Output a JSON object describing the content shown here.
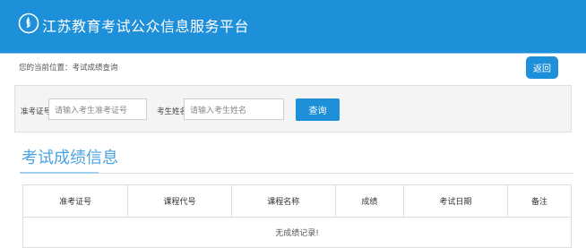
{
  "header": {
    "title": "江苏教育考试公众信息服务平台",
    "logo_icon": "flame-emblem-icon",
    "bg_color": "#1e8fd9"
  },
  "breadcrumb": {
    "text": "您的当前位置：考试成绩查询"
  },
  "back_button": {
    "label": "返回"
  },
  "search": {
    "ticket_label": "准考证号",
    "ticket_placeholder": "请输入考生准考证号",
    "name_label": "考生姓名",
    "name_placeholder": "请输入考生姓名",
    "query_label": "查询"
  },
  "section": {
    "title": "考试成绩信息",
    "accent_color": "#4aa3df"
  },
  "table": {
    "columns": [
      "准考证号",
      "课程代号",
      "课程名称",
      "成绩",
      "考试日期",
      "备注"
    ],
    "empty_message": "无成绩记录!"
  }
}
